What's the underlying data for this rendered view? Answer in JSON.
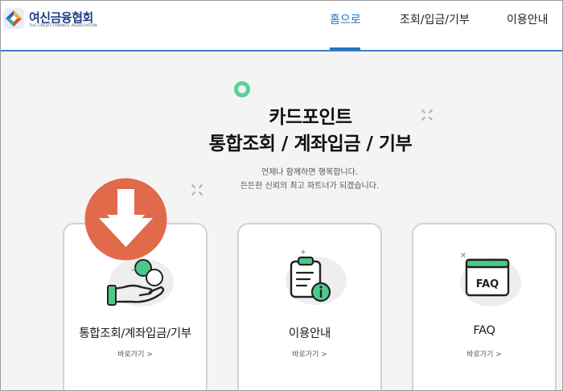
{
  "header": {
    "logo_text": "여신금융협회",
    "logo_subtitle": "THE CREDIT FINANCE ASSOCIATION",
    "nav": [
      {
        "label": "홈으로",
        "active": true
      },
      {
        "label": "조회/입금/기부",
        "active": false
      },
      {
        "label": "이용안내",
        "active": false
      }
    ],
    "accent_color": "#1f74c2"
  },
  "hero": {
    "title_line1": "카드포인트",
    "title_line2": "통합조회 / 계좌입금 / 기부",
    "desc_line1": "언제나 함께하면 행복합니다.",
    "desc_line2": "든든한 신뢰의 최고 파트너가 되겠습니다."
  },
  "cards": [
    {
      "title": "통합조회/계좌입금/기부",
      "link": "바로가기 >",
      "icon": "hand-coin-icon"
    },
    {
      "title": "이용안내",
      "link": "바로가기 >",
      "icon": "clipboard-info-icon"
    },
    {
      "title": "FAQ",
      "link": "바로가기 >",
      "icon": "faq-window-icon",
      "icon_text": "FAQ"
    }
  ],
  "overlay": {
    "icon": "down-arrow-icon",
    "color": "#e06a4a"
  }
}
